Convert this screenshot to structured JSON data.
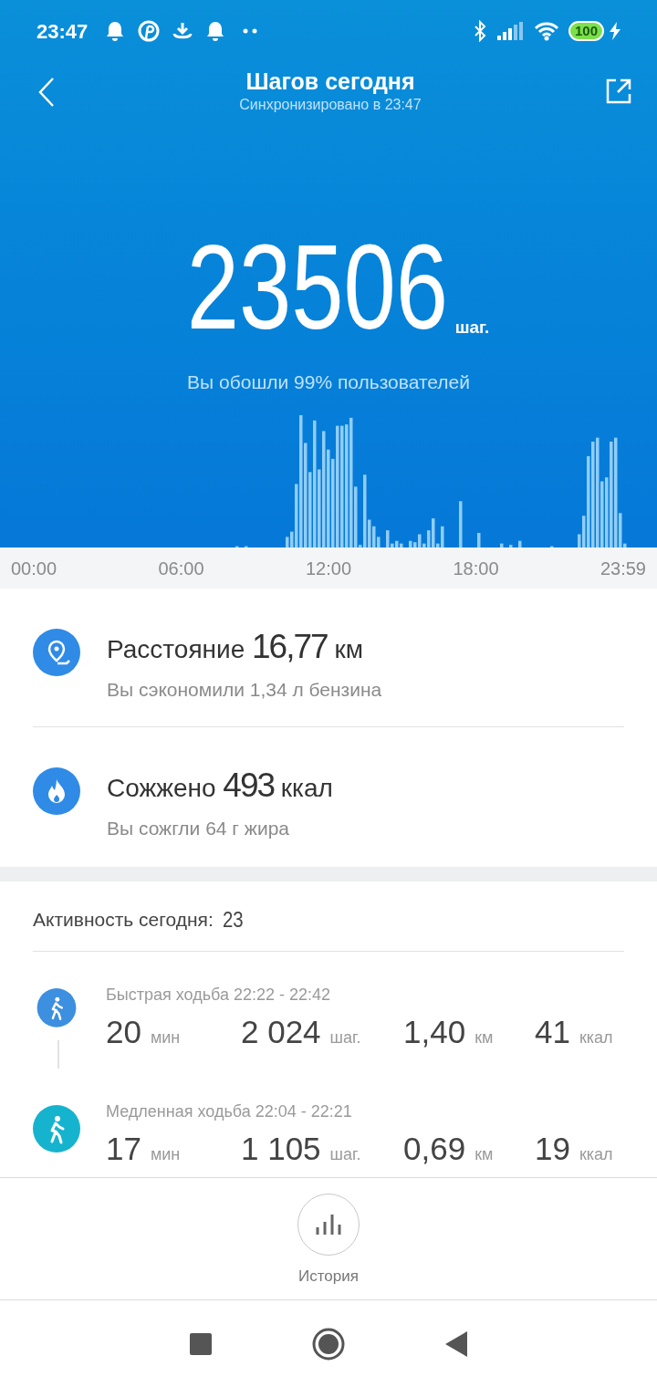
{
  "status_bar": {
    "time": "23:47",
    "battery": "100"
  },
  "header": {
    "title": "Шагов сегодня",
    "subtitle": "Синхронизировано в 23:47"
  },
  "steps": {
    "value": "23506",
    "unit": "шаг.",
    "note": "Вы обошли 99% пользователей"
  },
  "chart_axis": [
    "00:00",
    "06:00",
    "12:00",
    "18:00",
    "23:59"
  ],
  "summary": [
    {
      "kind": "distance",
      "text": "Расстояние **16,77** км",
      "note": "Вы сэкономили 1,34 л бензина"
    },
    {
      "kind": "calories",
      "text": "Сожжено **493** ккал",
      "note": "Вы сожгли 64 г жира"
    }
  ],
  "activity": {
    "label": "Активность сегодня:",
    "count": "23",
    "items": [
      {
        "title": "Быстрая ходьба 22:22 - 22:42",
        "color": "#3d8fe0",
        "metrics": [
          {
            "value": "20",
            "unit": "мин"
          },
          {
            "value": "2 024",
            "unit": "шаг."
          },
          {
            "value": "1,40",
            "unit": "км"
          },
          {
            "value": "41",
            "unit": "ккал"
          }
        ]
      },
      {
        "title": "Медленная ходьба 22:04 - 22:21",
        "color": "#16b3cf",
        "metrics": [
          {
            "value": "17",
            "unit": "мин"
          },
          {
            "value": "1 105",
            "unit": "шаг."
          },
          {
            "value": "0,69",
            "unit": "км"
          },
          {
            "value": "19",
            "unit": "ккал"
          }
        ]
      }
    ]
  },
  "history_button": {
    "label": "История"
  }
}
